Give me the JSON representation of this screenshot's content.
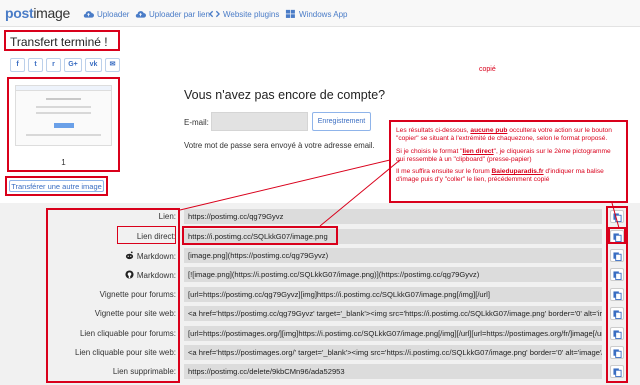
{
  "brand": {
    "logo_main": "post",
    "logo_rest": "image"
  },
  "nav": [
    {
      "label": "Uploader",
      "icon": "cloud-upload-icon"
    },
    {
      "label": "Uploader par lien",
      "icon": "cloud-link-icon"
    },
    {
      "label": "Website plugins",
      "icon": "code-icon"
    },
    {
      "label": "Windows App",
      "icon": "windows-icon"
    }
  ],
  "upload": {
    "status_title": "Transfert terminé !",
    "image_count": "1",
    "transfer_another_label": "Transférer une autre image",
    "share_buttons": [
      "f",
      "t",
      "r",
      "G+",
      "vk",
      "✉"
    ]
  },
  "account": {
    "title": "Vous n'avez pas encore de compte?",
    "email_label": "E-mail:",
    "email_value": "",
    "register_label": "Enregistrement",
    "password_note": "Votre mot de passe sera envoyé à votre adresse email."
  },
  "annotation": {
    "copie_label": "copié",
    "p1_before": "Les résultats ci-dessous, ",
    "p1_bold": "aucune pub",
    "p1_after": " occultera votre action sur le bouton \"copier\" se situant à l'extrémité de chaquezone, selon le format proposé.",
    "p2_before": "Si je choisis le format \"",
    "p2_bold": "lien direct",
    "p2_after": "\", je cliquerais sur le 2ème pictogramme qui ressemble à un \"clipboard\" (presse-papier)",
    "p3_before": "Il me suffira ensuite sur le forum ",
    "p3_bold": "Baieduparadis.fr",
    "p3_after": " d'indiquer ma balise d'image puis d'y \"coller\" le lien, précédemment   copié"
  },
  "links": [
    {
      "label": "Lien:",
      "value": "https://postimg.cc/qg79Gyvz"
    },
    {
      "label": "Lien direct:",
      "value": "https://i.postimg.cc/SQLkkG07/image.png"
    },
    {
      "label": "Markdown:",
      "value": "[image.png](https://postimg.cc/qg79Gyvz)",
      "icon": "reddit-icon"
    },
    {
      "label": "Markdown:",
      "value": "[![image.png](https://i.postimg.cc/SQLkkG07/image.png)](https://postimg.cc/qg79Gyvz)",
      "icon": "github-icon"
    },
    {
      "label": "Vignette pour forums:",
      "value": "[url=https://postimg.cc/qg79Gyvz][img]https://i.postimg.cc/SQLkkG07/image.png[/img][/url]"
    },
    {
      "label": "Vignette pour site web:",
      "value": "<a href='https://postimg.cc/qg79Gyvz' target='_blank'><img src='https://i.postimg.cc/SQLkkG07/image.png' border='0' alt='image'/></a>"
    },
    {
      "label": "Lien cliquable pour forums:",
      "value": "[url=https://postimages.org/][img]https://i.postimg.cc/SQLkkG07/image.png[/img][/url][url=https://postimages.org/fr/]image[/url]"
    },
    {
      "label": "Lien cliquable pour site web:",
      "value": "<a href='https://postimages.org/' target='_blank'><img src='https://i.postimg.cc/SQLkkG07/image.png' border='0' alt='image'/></a>"
    },
    {
      "label": "Lien supprimable:",
      "value": "https://postimg.cc/delete/9kbCMn96/ada52953"
    }
  ],
  "colors": {
    "brand_blue": "#4a7cc7",
    "annotation_red": "#d9001b",
    "field_grey": "#dcdcdc"
  }
}
